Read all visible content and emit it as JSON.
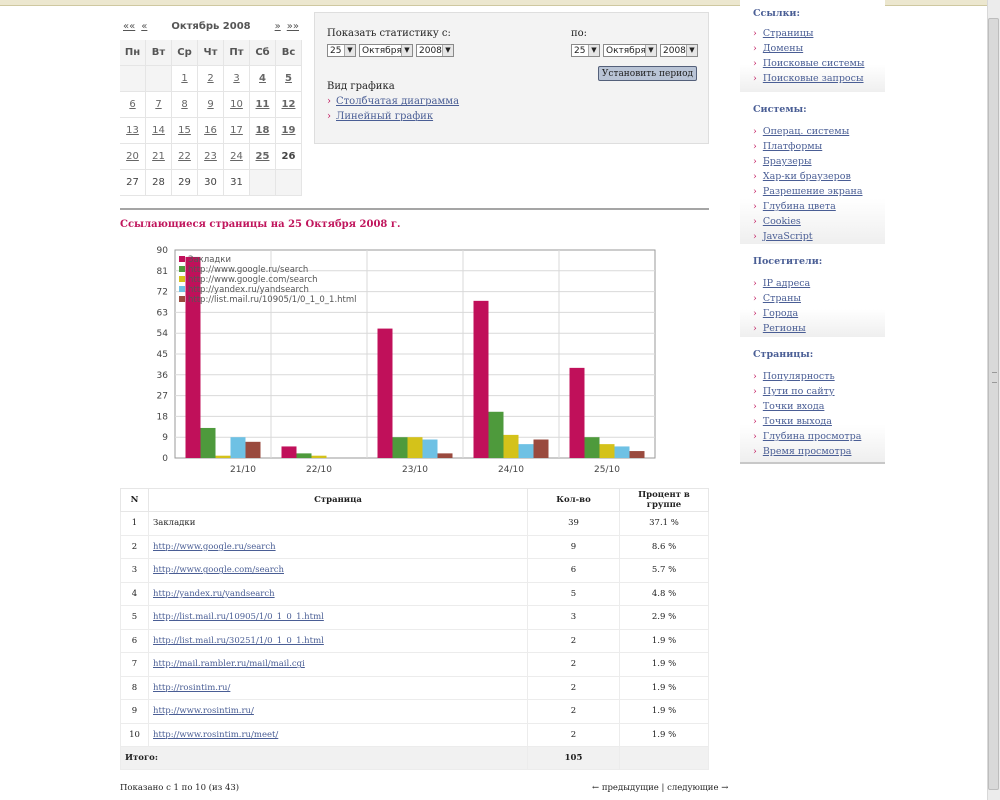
{
  "calendar": {
    "prev_year": "««",
    "prev_month": "«",
    "month": "Октябрь 2008",
    "next_month": "»",
    "next_year": "»»",
    "weekdays": [
      "Пн",
      "Вт",
      "Ср",
      "Чт",
      "Пт",
      "Сб",
      "Вс"
    ],
    "cells": [
      {
        "t": "",
        "k": "empty"
      },
      {
        "t": "",
        "k": "empty"
      },
      {
        "t": "1",
        "k": "link"
      },
      {
        "t": "2",
        "k": "link"
      },
      {
        "t": "3",
        "k": "link"
      },
      {
        "t": "4",
        "k": "link bold"
      },
      {
        "t": "5",
        "k": "link bold"
      },
      {
        "t": "6",
        "k": "link"
      },
      {
        "t": "7",
        "k": "link"
      },
      {
        "t": "8",
        "k": "link"
      },
      {
        "t": "9",
        "k": "link"
      },
      {
        "t": "10",
        "k": "link"
      },
      {
        "t": "11",
        "k": "link bold"
      },
      {
        "t": "12",
        "k": "link bold"
      },
      {
        "t": "13",
        "k": "link"
      },
      {
        "t": "14",
        "k": "link"
      },
      {
        "t": "15",
        "k": "link"
      },
      {
        "t": "16",
        "k": "link"
      },
      {
        "t": "17",
        "k": "link"
      },
      {
        "t": "18",
        "k": "link bold"
      },
      {
        "t": "19",
        "k": "link bold"
      },
      {
        "t": "20",
        "k": "link"
      },
      {
        "t": "21",
        "k": "link"
      },
      {
        "t": "22",
        "k": "link"
      },
      {
        "t": "23",
        "k": "link"
      },
      {
        "t": "24",
        "k": "link"
      },
      {
        "t": "25",
        "k": "link bold"
      },
      {
        "t": "26",
        "k": "bold"
      },
      {
        "t": "27",
        "k": ""
      },
      {
        "t": "28",
        "k": ""
      },
      {
        "t": "29",
        "k": ""
      },
      {
        "t": "30",
        "k": ""
      },
      {
        "t": "31",
        "k": ""
      },
      {
        "t": "",
        "k": "empty"
      },
      {
        "t": "",
        "k": "empty"
      }
    ]
  },
  "period": {
    "from_label": "Показать статистику с:",
    "to_label": "по:",
    "from": {
      "day": "25",
      "month": "Октября",
      "year": "2008"
    },
    "to": {
      "day": "25",
      "month": "Октября",
      "year": "2008"
    },
    "set_button": "Установить период",
    "graph_type_label": "Вид графика",
    "graph_types": [
      "Столбчатая диаграмма",
      "Линейный график"
    ]
  },
  "section_title": "Ссылающиеся страницы на 25 Октября 2008 г.",
  "chart_data": {
    "type": "bar",
    "categories": [
      "21/10",
      "22/10",
      "23/10",
      "24/10",
      "25/10"
    ],
    "ylim": [
      0,
      90
    ],
    "yticks": [
      "0",
      "9",
      "18",
      "27",
      "36",
      "45",
      "54",
      "63",
      "72",
      "81",
      "90"
    ],
    "grid": true,
    "legend_position": "top-left",
    "series": [
      {
        "name": "Закладки",
        "color": "#c0105a",
        "values": [
          87,
          5,
          56,
          68,
          39
        ]
      },
      {
        "name": "http://www.google.ru/search",
        "color": "#4e9a3c",
        "values": [
          13,
          2,
          9,
          20,
          9
        ]
      },
      {
        "name": "http://www.google.com/search",
        "color": "#d4c21a",
        "values": [
          1,
          1,
          9,
          10,
          6
        ]
      },
      {
        "name": "http://yandex.ru/yandsearch",
        "color": "#6ec1e4",
        "values": [
          9,
          0,
          8,
          6,
          5
        ]
      },
      {
        "name": "http://list.mail.ru/10905/1/0_1_0_1.html",
        "color": "#9a4a3e",
        "values": [
          7,
          0,
          2,
          8,
          3
        ]
      }
    ]
  },
  "table": {
    "headers": {
      "n": "N",
      "page": "Страница",
      "count": "Кол-во",
      "percent": "Процент в группе"
    },
    "rows": [
      {
        "n": "1",
        "page": "Закладки",
        "count": "39",
        "percent": "37.1 %",
        "link": false
      },
      {
        "n": "2",
        "page": "http://www.google.ru/search",
        "count": "9",
        "percent": "8.6 %",
        "link": true
      },
      {
        "n": "3",
        "page": "http://www.google.com/search",
        "count": "6",
        "percent": "5.7 %",
        "link": true
      },
      {
        "n": "4",
        "page": "http://yandex.ru/yandsearch",
        "count": "5",
        "percent": "4.8 %",
        "link": true
      },
      {
        "n": "5",
        "page": "http://list.mail.ru/10905/1/0_1_0_1.html",
        "count": "3",
        "percent": "2.9 %",
        "link": true
      },
      {
        "n": "6",
        "page": "http://list.mail.ru/30251/1/0_1_0_1.html",
        "count": "2",
        "percent": "1.9 %",
        "link": true
      },
      {
        "n": "7",
        "page": "http://mail.rambler.ru/mail/mail.cgi",
        "count": "2",
        "percent": "1.9 %",
        "link": true
      },
      {
        "n": "8",
        "page": "http://rosintim.ru/",
        "count": "2",
        "percent": "1.9 %",
        "link": true
      },
      {
        "n": "9",
        "page": "http://www.rosintim.ru/",
        "count": "2",
        "percent": "1.9 %",
        "link": true
      },
      {
        "n": "10",
        "page": "http://www.rosintim.ru/meet/",
        "count": "2",
        "percent": "1.9 %",
        "link": true
      }
    ],
    "total_label": "Итого:",
    "total_count": "105"
  },
  "footer": {
    "shown": "Показано с 1 по 10 (из 43)",
    "prev": "← предыдущие",
    "sep": "|",
    "next": "следующие →"
  },
  "sidebar": [
    {
      "title": "Ссылки:",
      "items": [
        "Страницы",
        "Домены",
        "Поисковые системы",
        "Поисковые запросы"
      ]
    },
    {
      "title": "Системы:",
      "items": [
        "Операц. системы",
        "Платформы",
        "Браузеры",
        "Хар-ки браузеров",
        "Разрешение экрана",
        "Глубина цвета",
        "Cookies",
        "JavaScript"
      ]
    },
    {
      "title": "Посетители:",
      "items": [
        "IP адреса",
        "Страны",
        "Города",
        "Регионы"
      ]
    },
    {
      "title": "Страницы:",
      "items": [
        "Популярность",
        "Пути по сайту",
        "Точки входа",
        "Точки выхода",
        "Глубина просмотра",
        "Время просмотра"
      ]
    }
  ]
}
